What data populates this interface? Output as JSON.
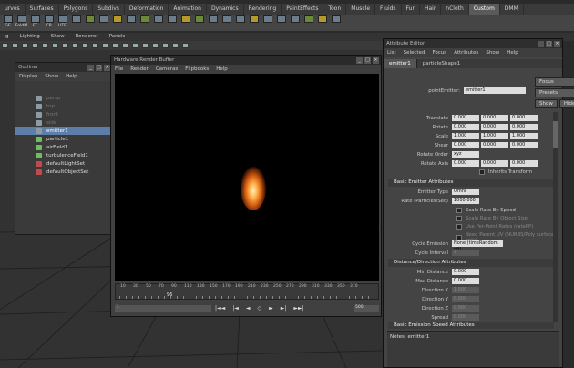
{
  "shelf": {
    "tabs": [
      "urves",
      "Surfaces",
      "Polygons",
      "Subdivs",
      "Deformation",
      "Animation",
      "Dynamics",
      "Rendering",
      "PaintEffects",
      "Toon",
      "Muscle",
      "Fluids",
      "Fur",
      "Hair",
      "nCloth",
      "Custom",
      "DMM"
    ],
    "active_tab": "Custom",
    "icons": [
      "GE",
      "FoldM",
      "FT",
      "CP",
      "UTE"
    ]
  },
  "panel_menu": [
    "g",
    "Lighting",
    "Show",
    "Renderer",
    "Panels"
  ],
  "outliner": {
    "title": "Outliner",
    "menu": [
      "Display",
      "Show",
      "Help"
    ],
    "items": [
      {
        "label": "persp",
        "state": "dim",
        "icon": "camera-icon"
      },
      {
        "label": "top",
        "state": "dim",
        "icon": "camera-icon"
      },
      {
        "label": "front",
        "state": "dim",
        "icon": "camera-icon"
      },
      {
        "label": "side",
        "state": "dim",
        "icon": "camera-icon"
      },
      {
        "label": "emitter1",
        "state": "selected",
        "icon": "emitter-icon"
      },
      {
        "label": "particle1",
        "state": "normal",
        "icon": "particle-icon"
      },
      {
        "label": "airField1",
        "state": "normal",
        "icon": "field-icon"
      },
      {
        "label": "turbulenceField1",
        "state": "normal",
        "icon": "field-icon"
      },
      {
        "label": "defaultLightSet",
        "state": "normal",
        "icon": "set-icon"
      },
      {
        "label": "defaultObjectSet",
        "state": "normal",
        "icon": "set-icon"
      }
    ]
  },
  "render_buffer": {
    "title": "Hardware Render Buffer",
    "menu": [
      "File",
      "Render",
      "Cameras",
      "Flipbooks",
      "Help"
    ],
    "timeline_ticks": [
      "10",
      "20",
      "30",
      "40",
      "50",
      "60",
      "70",
      "80",
      "90",
      "100",
      "110",
      "120",
      "130",
      "140",
      "150",
      "160",
      "170",
      "180",
      "190",
      "200",
      "210",
      "220",
      "230",
      "240",
      "250",
      "260",
      "270",
      "280",
      "290",
      "300",
      "310",
      "320",
      "330",
      "340",
      "350",
      "360",
      "370",
      "380",
      "390",
      "400"
    ],
    "current_frame": "96",
    "range_start": "1",
    "range_end": "500"
  },
  "attribute_editor": {
    "title": "Attribute Editor",
    "menu": [
      "List",
      "Selected",
      "Focus",
      "Attributes",
      "Show",
      "Help"
    ],
    "tabs": [
      "emitter1",
      "particleShape1"
    ],
    "node_label": "pointEmitter:",
    "node_value": "emitter1",
    "buttons": {
      "focus": "Focus",
      "presets": "Presets",
      "show": "Show",
      "hide": "Hide"
    },
    "transform": [
      {
        "label": "Translate",
        "values": [
          "0.000",
          "0.000",
          "0.000"
        ]
      },
      {
        "label": "Rotate",
        "values": [
          "0.000",
          "0.000",
          "0.000"
        ]
      },
      {
        "label": "Scale",
        "values": [
          "1.000",
          "1.000",
          "1.000"
        ]
      },
      {
        "label": "Shear",
        "values": [
          "0.000",
          "0.000",
          "0.000"
        ]
      }
    ],
    "rotate_order": {
      "label": "Rotate Order",
      "value": "xyz"
    },
    "rotate_axis": {
      "label": "Rotate Axis",
      "values": [
        "0.000",
        "0.000",
        "0.000"
      ]
    },
    "inherits_transform": "Inherits Transform",
    "basic_emitter": {
      "header": "Basic Emitter Attributes",
      "emitter_type_label": "Emitter Type",
      "emitter_type_value": "Omni",
      "rate_label": "Rate (Particles/Sec)",
      "rate_value": "1000.000",
      "checks": [
        "Scale Rate By Speed",
        "Scale Rate By Object Size",
        "Use Per-Point Rates (ratePP)",
        "Need Parent UV (NURBS/Poly surfaces only)"
      ],
      "cycle_emission_label": "Cycle Emission",
      "cycle_emission_value": "None (timeRandom off)",
      "cycle_interval_label": "Cycle Interval",
      "cycle_interval_value": "1"
    },
    "distance_direction": {
      "header": "Distance/Direction Attributes",
      "min_label": "Min Distance",
      "min_value": "0.000",
      "max_label": "Max Distance",
      "max_value": "0.000",
      "dir_x_label": "Direction X",
      "dir_x_value": "1.000",
      "dir_y_label": "Direction Y",
      "dir_y_value": "0.000",
      "dir_z_label": "Direction Z",
      "dir_z_value": "0.000",
      "spread_label": "Spread",
      "spread_value": "0.000"
    },
    "basic_speed_header": "Basic Emission Speed Attributes",
    "notes": "Notes: emitter1"
  }
}
